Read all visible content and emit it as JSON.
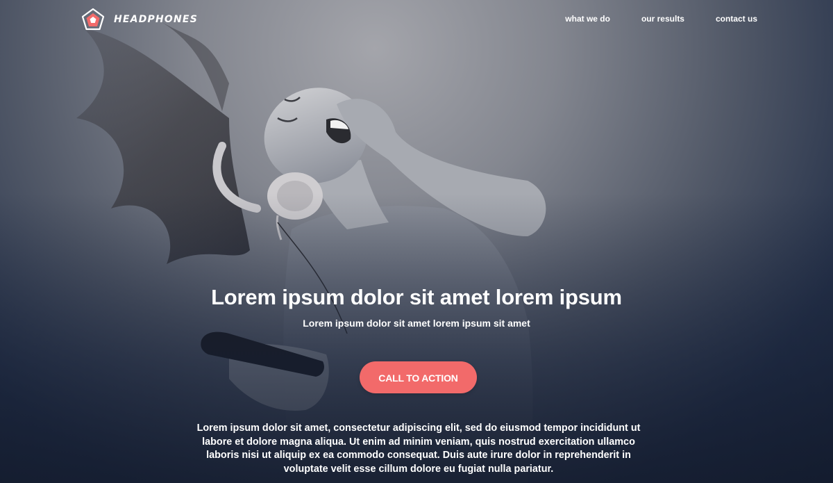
{
  "brand": {
    "name": "HEADPHONES",
    "logo_icon": "pentagon-logo-icon",
    "accent_color": "#f26a6a"
  },
  "nav": {
    "items": [
      {
        "label": "what we do"
      },
      {
        "label": "our results"
      },
      {
        "label": "contact us"
      }
    ]
  },
  "hero": {
    "background_image": "woman-listening-headphones-photo",
    "title": "Lorem ipsum dolor sit amet lorem ipsum",
    "subtitle": "Lorem ipsum dolor sit amet lorem ipsum sit amet",
    "cta_label": "CALL TO ACTION",
    "body": "Lorem ipsum dolor sit amet, consectetur adipiscing elit, sed do eiusmod tempor incididunt ut labore et dolore magna aliqua. Ut enim ad minim veniam, quis nostrud exercitation ullamco laboris nisi ut aliquip ex ea commodo consequat. Duis aute irure dolor in reprehenderit in voluptate velit esse cillum dolore eu fugiat nulla pariatur."
  }
}
